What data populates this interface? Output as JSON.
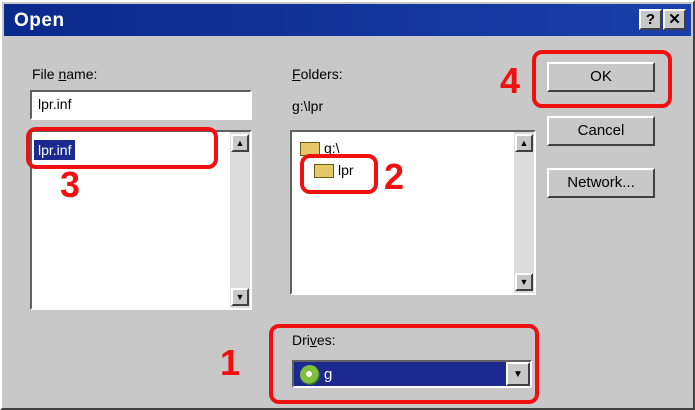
{
  "window": {
    "title": "Open",
    "help_btn": "?",
    "close_btn": "✕"
  },
  "file_name": {
    "label_pre": "File ",
    "label_ul": "n",
    "label_post": "ame:",
    "value": "lpr.inf"
  },
  "file_list": {
    "items": [
      "lpr.inf"
    ]
  },
  "folders": {
    "label_ul": "F",
    "label_post": "olders:",
    "path": "g:\\lpr",
    "items": [
      "g:\\",
      "lpr"
    ]
  },
  "drives": {
    "label_pre": "Dri",
    "label_ul": "v",
    "label_post": "es:",
    "value": "g"
  },
  "buttons": {
    "ok": "OK",
    "cancel": "Cancel",
    "network": "Network..."
  },
  "callouts": [
    "1",
    "2",
    "3",
    "4"
  ],
  "colors": {
    "highlight": "#f01010",
    "titlebar": "#0a2a8c",
    "selection": "#1c2a90"
  },
  "icons": {
    "scroll_up": "▲",
    "scroll_down": "▼",
    "combo_down": "▼"
  }
}
